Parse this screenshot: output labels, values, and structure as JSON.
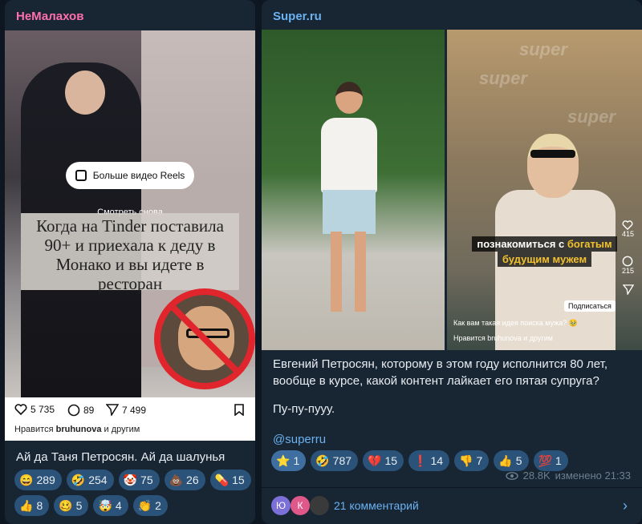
{
  "left_post": {
    "channel": "НеМалахов",
    "reels_button": "Больше видео Reels",
    "watch_again": "Смотреть снова",
    "image_caption_lines": [
      "Когда на Tinder поставила",
      "90+ и приехала к деду в",
      "Монако и вы идете в",
      "ресторан"
    ],
    "ig_likes": "5 735",
    "ig_comments": "89",
    "ig_shares": "7 499",
    "ig_liked_by_prefix": "Нравится",
    "ig_liked_by_user": "bruhunova",
    "ig_liked_by_suffix": "и другим",
    "text": "Ай да Таня Петросян. Ай да шалунья",
    "reactions": [
      {
        "emoji": "😄",
        "count": "289"
      },
      {
        "emoji": "🤣",
        "count": "254"
      },
      {
        "emoji": "🤡",
        "count": "75"
      },
      {
        "emoji": "💩",
        "count": "26"
      },
      {
        "emoji": "💊",
        "count": "15"
      },
      {
        "emoji": "👍",
        "count": "8"
      },
      {
        "emoji": "🥴",
        "count": "5"
      },
      {
        "emoji": "🤯",
        "count": "4"
      },
      {
        "emoji": "👏",
        "count": "2"
      }
    ]
  },
  "right_post": {
    "channel": "Super.ru",
    "watermark": "super",
    "tiktok_caption": {
      "part1": "познакомиться с ",
      "highlight1": "богатым",
      "highlight2": "будущим мужем"
    },
    "tiktok_counts": [
      "415",
      "215"
    ],
    "tiktok_subscribe": "Подписаться",
    "tiktok_question": "Как вам такая идея поиска мужа? 🥹",
    "tiktok_liked": "Нравится bruhunova и другим",
    "text_paragraph": "Евгений Петросян, которому в этом году исполнится 80 лет, вообще в курсе, какой контент лайкает его пятая супруга?",
    "text_line2": "Пу-пу-пууу.",
    "link": "@superru",
    "reactions": [
      {
        "emoji": "⭐",
        "count": "1",
        "mine": true
      },
      {
        "emoji": "🤣",
        "count": "787"
      },
      {
        "emoji": "💔",
        "count": "15"
      },
      {
        "emoji": "❗",
        "count": "14"
      },
      {
        "emoji": "👎",
        "count": "7"
      },
      {
        "emoji": "👍",
        "count": "5"
      },
      {
        "emoji": "💯",
        "count": "1"
      }
    ],
    "views": "28.8K",
    "edited": "изменено 21:33",
    "avatars": [
      {
        "letter": "Ю",
        "color": "#7b6fd8"
      },
      {
        "letter": "К",
        "color": "#e0588a"
      },
      {
        "letter": "",
        "color": "#3a3a3a"
      }
    ],
    "comments": "21 комментарий"
  }
}
